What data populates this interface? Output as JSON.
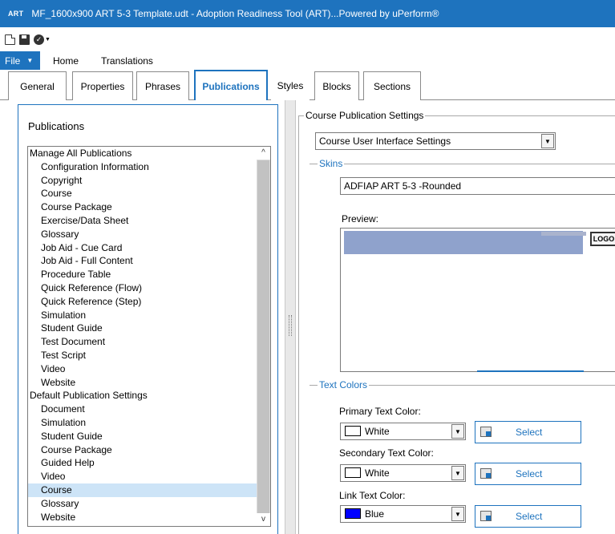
{
  "window": {
    "app_badge": "ART",
    "title": "MF_1600x900 ART 5-3 Template.udt - Adoption Readiness Tool (ART)...Powered by uPerform®"
  },
  "menu": {
    "file_label": "File",
    "items": [
      "Home",
      "Translations"
    ]
  },
  "tabs": [
    {
      "label": "General"
    },
    {
      "label": "Properties"
    },
    {
      "label": "Phrases"
    },
    {
      "label": "Publications",
      "active": true
    },
    {
      "label": "Styles"
    },
    {
      "label": "Blocks"
    },
    {
      "label": "Sections"
    }
  ],
  "publications": {
    "header": "Publications",
    "list": [
      {
        "label": "Manage All Publications",
        "level": 0
      },
      {
        "label": "Configuration Information",
        "level": 1
      },
      {
        "label": "Copyright",
        "level": 1
      },
      {
        "label": "Course",
        "level": 1
      },
      {
        "label": "Course Package",
        "level": 1
      },
      {
        "label": "Exercise/Data Sheet",
        "level": 1
      },
      {
        "label": "Glossary",
        "level": 1
      },
      {
        "label": "Job Aid - Cue Card",
        "level": 1
      },
      {
        "label": "Job Aid - Full Content",
        "level": 1
      },
      {
        "label": "Procedure Table",
        "level": 1
      },
      {
        "label": "Quick Reference (Flow)",
        "level": 1
      },
      {
        "label": "Quick Reference (Step)",
        "level": 1
      },
      {
        "label": "Simulation",
        "level": 1
      },
      {
        "label": "Student Guide",
        "level": 1
      },
      {
        "label": "Test Document",
        "level": 1
      },
      {
        "label": "Test Script",
        "level": 1
      },
      {
        "label": "Video",
        "level": 1
      },
      {
        "label": "Website",
        "level": 1
      },
      {
        "label": "Default Publication Settings",
        "level": 0
      },
      {
        "label": "Document",
        "level": 1
      },
      {
        "label": "Simulation",
        "level": 1
      },
      {
        "label": "Student Guide",
        "level": 1
      },
      {
        "label": "Course Package",
        "level": 1
      },
      {
        "label": "Guided Help",
        "level": 1
      },
      {
        "label": "Video",
        "level": 1
      },
      {
        "label": "Course",
        "level": 1,
        "selected": true
      },
      {
        "label": "Glossary",
        "level": 1
      },
      {
        "label": "Website",
        "level": 1
      }
    ]
  },
  "settings": {
    "group_title": "Course Publication Settings",
    "settings_dropdown": "Course User Interface Settings",
    "skins_label": "Skins",
    "skin_value": "ADFIAP ART 5-3 -Rounded",
    "preview_label": "Preview:",
    "preview_logo": "LOGO",
    "text_colors_label": "Text Colors",
    "primary_label": "Primary Text Color:",
    "primary_value": "White",
    "primary_color": "#ffffff",
    "secondary_label": "Secondary Text Color:",
    "secondary_value": "White",
    "secondary_color": "#ffffff",
    "link_label": "Link Text Color:",
    "link_value": "Blue",
    "link_color": "#0000ff",
    "select_label": "Select"
  },
  "colors": {
    "accent": "#1e73be",
    "selection": "#cde4f7"
  }
}
